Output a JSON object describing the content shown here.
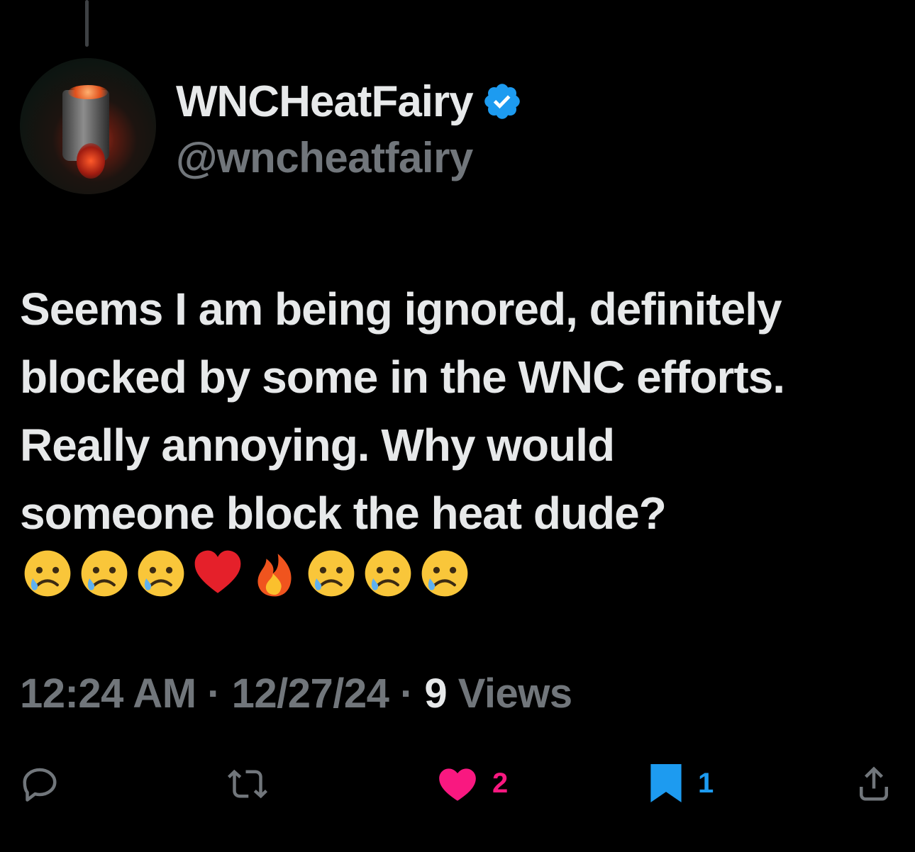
{
  "author": {
    "display_name": "WNCHeatFairy",
    "handle": "@wncheatfairy",
    "verified": true
  },
  "tweet": {
    "text": "Seems I am being ignored, definitely\nblocked by some in the WNC efforts.\nReally annoying. Why would\nsomeone block the heat dude?",
    "emojis": [
      "crying-face",
      "crying-face",
      "crying-face",
      "red-heart",
      "fire",
      "crying-face",
      "crying-face",
      "crying-face"
    ]
  },
  "meta": {
    "time": "12:24 AM",
    "separator": " · ",
    "date": "12/27/24",
    "views_count": "9",
    "views_label": " Views"
  },
  "actions": {
    "likes_count": "2",
    "bookmarks_count": "1"
  },
  "colors": {
    "background": "#000000",
    "primary_text": "#e7e9ea",
    "secondary_text": "#71767b",
    "like": "#f91880",
    "bookmark": "#1d9bf0",
    "verified": "#1d9bf0"
  }
}
